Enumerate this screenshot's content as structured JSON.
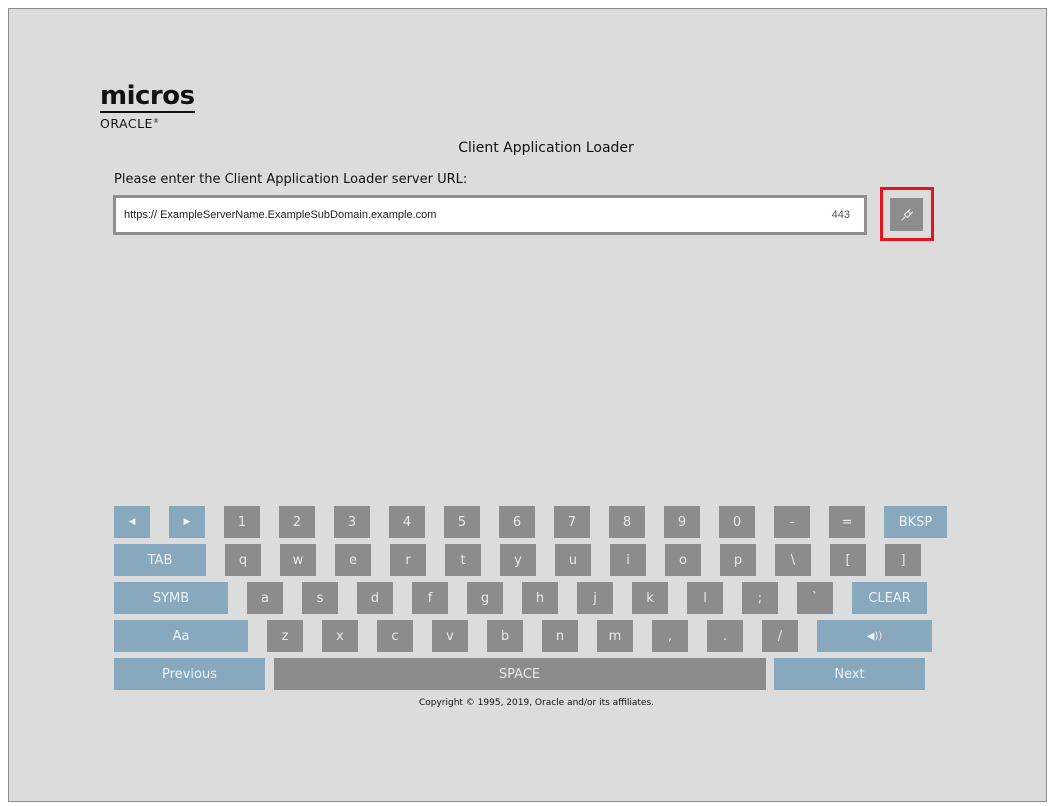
{
  "logo": {
    "micros": "micros",
    "oracle": "ORACLE",
    "mark": "®"
  },
  "header": {
    "title": "Client Application Loader"
  },
  "form": {
    "prompt": "Please enter the Client Application Loader server URL:",
    "url_value": "https:// ExampleServerName.ExampleSubDomain.example.com",
    "port_value": "443",
    "connect_icon": "plug-icon",
    "highlight_color": "#e8131c"
  },
  "keyboard": {
    "colors": {
      "char_key": "#8c8c8c",
      "function_key": "#88a9bd",
      "background": "#dcdcdc"
    },
    "row1": [
      "◀",
      "▶",
      "1",
      "2",
      "3",
      "4",
      "5",
      "6",
      "7",
      "8",
      "9",
      "0",
      "-",
      "=",
      "BKSP"
    ],
    "row2": [
      "TAB",
      "q",
      "w",
      "e",
      "r",
      "t",
      "y",
      "u",
      "i",
      "o",
      "p",
      "\\",
      "[",
      "]"
    ],
    "row3": [
      "SYMB",
      "a",
      "s",
      "d",
      "f",
      "g",
      "h",
      "j",
      "k",
      "l",
      ";",
      "`",
      "CLEAR"
    ],
    "row4": [
      "Aa",
      "z",
      "x",
      "c",
      "v",
      "b",
      "n",
      "m",
      ",",
      ".",
      "/",
      "◀))"
    ],
    "row5": [
      "Previous",
      "SPACE",
      "Next"
    ]
  },
  "footer": {
    "copyright": "Copyright © 1995, 2019, Oracle and/or its affiliates."
  }
}
